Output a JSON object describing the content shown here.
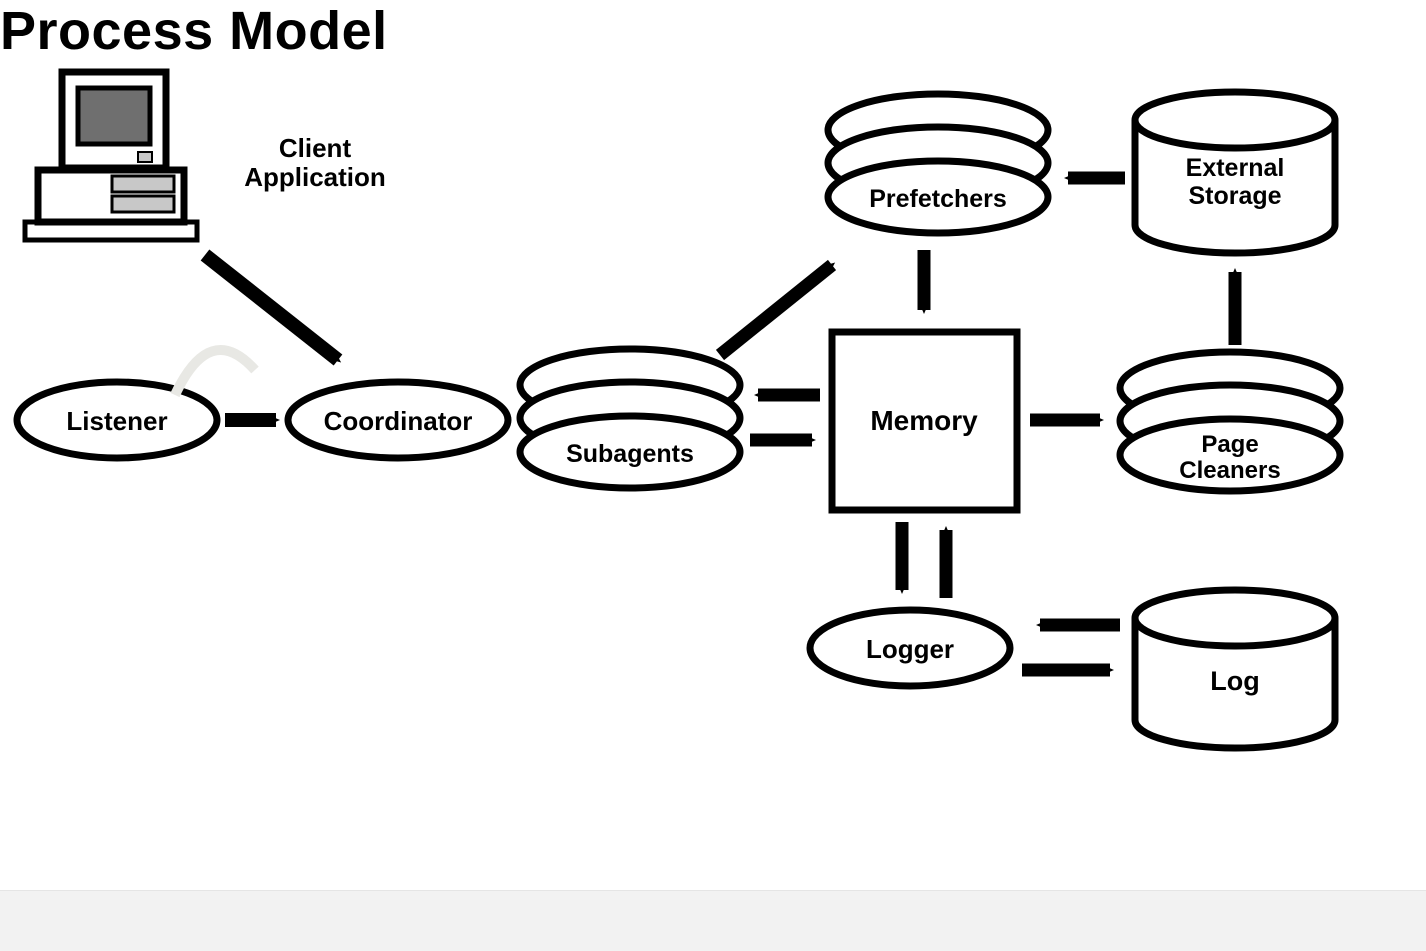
{
  "title": "Process Model",
  "client_label_line1": "Client",
  "client_label_line2": "Application",
  "nodes": {
    "listener": "Listener",
    "coordinator": "Coordinator",
    "subagents": "Subagents",
    "prefetchers": "Prefetchers",
    "memory": "Memory",
    "page_cleaners_line1": "Page",
    "page_cleaners_line2": "Cleaners",
    "external_storage_line1": "External",
    "external_storage_line2": "Storage",
    "logger": "Logger",
    "log": "Log"
  }
}
